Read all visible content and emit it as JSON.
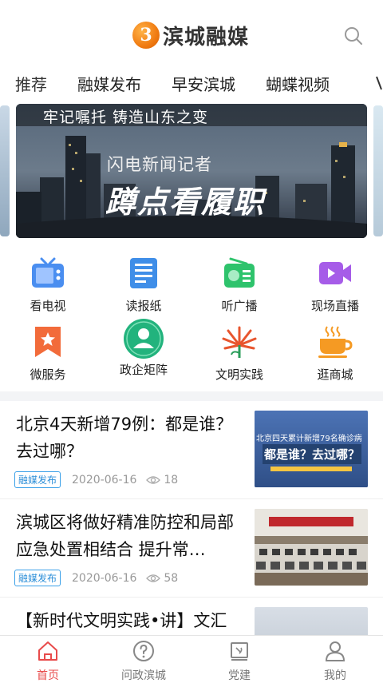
{
  "app": {
    "logo_text": "滨城融媒",
    "logo_mark": "3"
  },
  "tabs": [
    "推荐",
    "融媒发布",
    "早安滨城",
    "蝴蝶视频"
  ],
  "banner": {
    "slogan": "牢记嘱托 铸造山东之变",
    "subtitle": "闪电新闻记者",
    "title": "蹲点看履职"
  },
  "grid": [
    {
      "label": "看电视",
      "icon": "tv-icon",
      "color": "#4a8ef0"
    },
    {
      "label": "读报纸",
      "icon": "newspaper-icon",
      "color": "#3f8ee8"
    },
    {
      "label": "听广播",
      "icon": "radio-icon",
      "color": "#2ec36c"
    },
    {
      "label": "现场直播",
      "icon": "video-camera-icon",
      "color": "#a65ce8"
    },
    {
      "label": "微服务",
      "icon": "star-bookmark-icon",
      "color": "#f26b3a"
    },
    {
      "label": "政企矩阵",
      "icon": "user-circle-icon",
      "color": "#22b37d"
    },
    {
      "label": "文明实践",
      "icon": "flower-icon",
      "color": "#e8552e"
    },
    {
      "label": "逛商城",
      "icon": "cup-icon",
      "color": "#f59a23"
    }
  ],
  "news": [
    {
      "title": "北京4天新增79例：都是谁？去过哪？",
      "tag": "融媒发布",
      "date": "2020-06-16",
      "views": "18",
      "thumb_text_1": "北京四天累计新增79名确诊病",
      "thumb_text_2": "都是谁？去过哪？"
    },
    {
      "title": "滨城区将做好精准防控和局部应急处置相结合 提升常…",
      "tag": "融媒发布",
      "date": "2020-06-16",
      "views": "58"
    },
    {
      "title": "【新时代文明实践•讲】文汇"
    }
  ],
  "bottom_nav": [
    {
      "label": "首页",
      "icon": "home-icon",
      "active": true
    },
    {
      "label": "问政滨城",
      "icon": "question-circle-icon",
      "active": false
    },
    {
      "label": "党建",
      "icon": "party-flag-icon",
      "active": false
    },
    {
      "label": "我的",
      "icon": "user-icon",
      "active": false
    }
  ],
  "colors": {
    "accent": "#e84b4b",
    "tag_blue": "#2d8fd8",
    "logo_orange": "#f07b12"
  }
}
